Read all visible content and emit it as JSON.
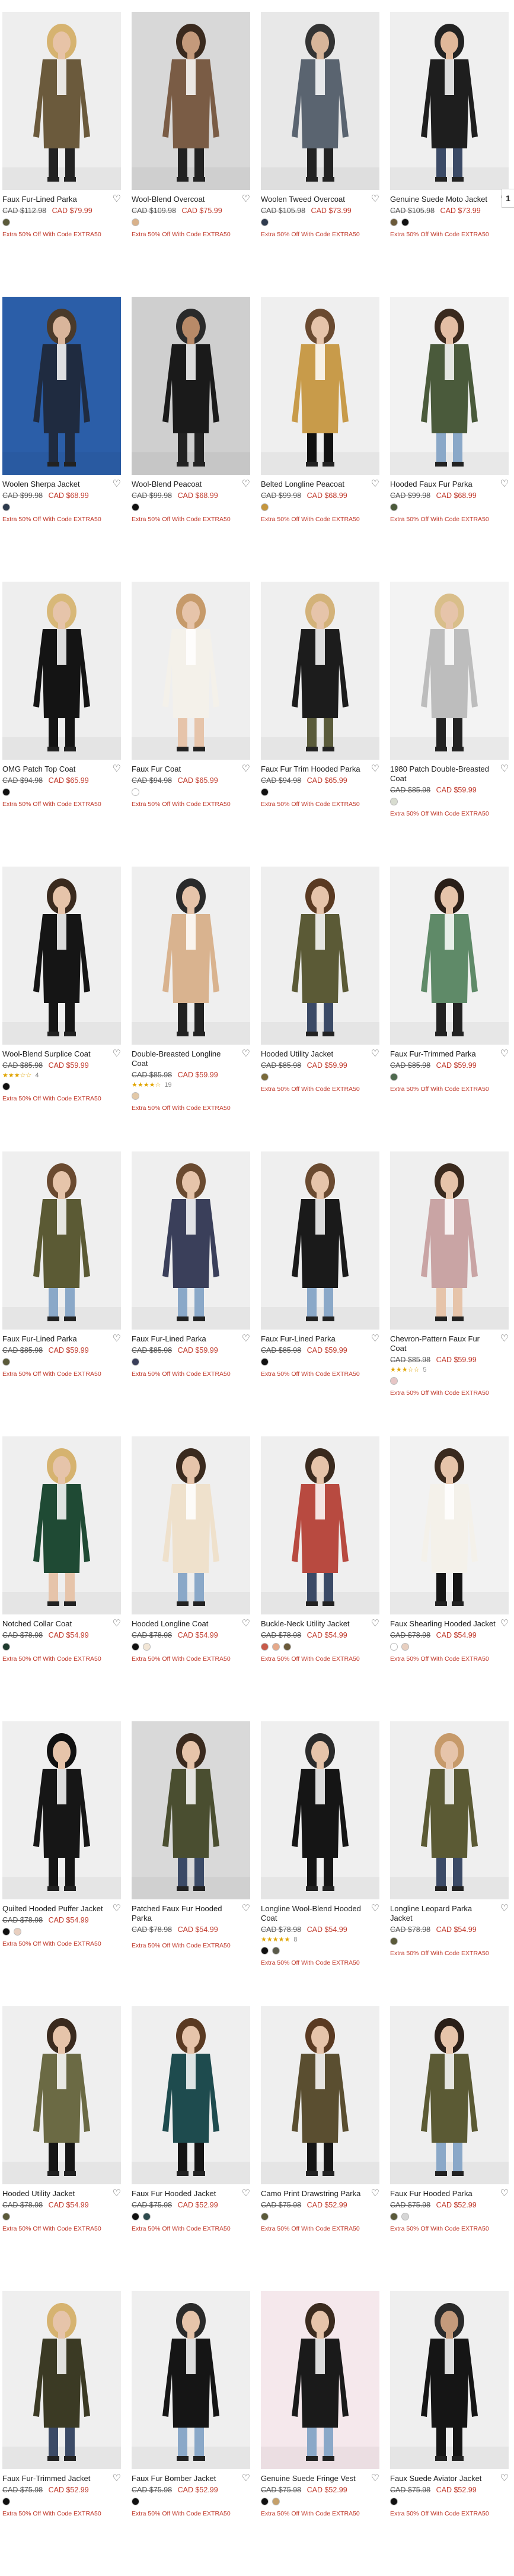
{
  "promo_text": "Extra 50% Off With Code EXTRA50",
  "side_tab_label": "1",
  "products": [
    {
      "title": "Faux Fur-Lined Parka",
      "old": "CAD $112.98",
      "now": "CAD $79.99",
      "swatches": [
        "#5b5a3a"
      ],
      "bg": "#eeeeee",
      "coat": "#6b5a3c",
      "skin": "#e7c3a7",
      "hair": "#d6b370",
      "legs": "#222222"
    },
    {
      "title": "Wool-Blend Overcoat",
      "old": "CAD $109.98",
      "now": "CAD $75.99",
      "swatches": [
        "#d9b28b"
      ],
      "bg": "#d8d8d8",
      "coat": "#7a5c45",
      "skin": "#c49a7b",
      "hair": "#3a2a1e",
      "legs": "#222222"
    },
    {
      "title": "Woolen Tweed Overcoat",
      "old": "CAD $105.98",
      "now": "CAD $73.99",
      "swatches": [
        "#2e3b4e"
      ],
      "bg": "#e8e8e8",
      "coat": "#5a6470",
      "skin": "#d7b59a",
      "hair": "#333333",
      "legs": "#222222"
    },
    {
      "title": "Genuine Suede Moto Jacket",
      "old": "CAD $105.98",
      "now": "CAD $73.99",
      "swatches": [
        "#6b5a3a",
        "#111111"
      ],
      "bg": "#efefef",
      "coat": "#1e1e1e",
      "skin": "#e0b89a",
      "hair": "#222222",
      "legs": "#3b4a66"
    },
    {
      "title": "Woolen Sherpa Jacket",
      "old": "CAD $99.98",
      "now": "CAD $68.99",
      "swatches": [
        "#2e3b4e"
      ],
      "bg": "#2b5ea8",
      "coat": "#1f2b40",
      "skin": "#d9b59b",
      "hair": "#4a3a2a",
      "legs": "#1f2b40"
    },
    {
      "title": "Wool-Blend Peacoat",
      "old": "CAD $99.98",
      "now": "CAD $68.99",
      "swatches": [
        "#111111"
      ],
      "bg": "#cfcfcf",
      "coat": "#1a1a1a",
      "skin": "#b88a68",
      "hair": "#2a2a2a",
      "legs": "#222222"
    },
    {
      "title": "Belted Longline Peacoat",
      "old": "CAD $99.98",
      "now": "CAD $68.99",
      "swatches": [
        "#c5963e"
      ],
      "bg": "#efefef",
      "coat": "#c89b4a",
      "skin": "#e6c4aa",
      "hair": "#6a4a30",
      "legs": "#111111"
    },
    {
      "title": "Hooded Faux Fur Parka",
      "old": "CAD $99.98",
      "now": "CAD $68.99",
      "swatches": [
        "#4b5a3a"
      ],
      "bg": "#f2f2f2",
      "coat": "#4a5a3b",
      "skin": "#e3bea4",
      "hair": "#3a2a1e",
      "legs": "#8aa8c8"
    },
    {
      "title": "OMG Patch Top Coat",
      "old": "CAD $94.98",
      "now": "CAD $65.99",
      "swatches": [
        "#111111"
      ],
      "bg": "#eeeeee",
      "coat": "#141414",
      "skin": "#e6c4aa",
      "hair": "#d8b878",
      "legs": "#141414"
    },
    {
      "title": "Faux Fur Coat",
      "old": "CAD $94.98",
      "now": "CAD $65.99",
      "swatches": [
        "#ffffff"
      ],
      "bg": "#efefef",
      "coat": "#f4f1ea",
      "skin": "#e6c4aa",
      "hair": "#c69a6a",
      "legs": "#e6c4aa"
    },
    {
      "title": "Faux Fur Trim Hooded Parka",
      "old": "CAD $94.98",
      "now": "CAD $65.99",
      "swatches": [
        "#111111"
      ],
      "bg": "#efefef",
      "coat": "#1c1c1c",
      "skin": "#e6c4aa",
      "hair": "#d3b279",
      "legs": "#5a5b3a"
    },
    {
      "title": "1980 Patch Double-Breasted Coat",
      "old": "CAD $85.98",
      "now": "CAD $59.99",
      "swatches": [
        "#d8dcd0"
      ],
      "bg": "#f3f3f3",
      "coat": "#bdbdbd",
      "skin": "#e6c4aa",
      "hair": "#d9be8a",
      "legs": "#222222"
    },
    {
      "title": "Wool-Blend Surplice Coat",
      "old": "CAD $85.98",
      "now": "CAD $59.99",
      "swatches": [
        "#111111"
      ],
      "bg": "#efefef",
      "coat": "#151515",
      "skin": "#e6c4aa",
      "hair": "#3a2a1e",
      "legs": "#151515",
      "stars": "★★★☆☆",
      "reviews": "4"
    },
    {
      "title": "Double-Breasted Longline Coat",
      "old": "CAD $85.98",
      "now": "CAD $59.99",
      "swatches": [
        "#e3c9a8"
      ],
      "bg": "#efefef",
      "coat": "#d9b38f",
      "skin": "#e6c4aa",
      "hair": "#2a2a2a",
      "legs": "#222222",
      "stars": "★★★★☆",
      "reviews": "19"
    },
    {
      "title": "Hooded Utility Jacket",
      "old": "CAD $85.98",
      "now": "CAD $59.99",
      "swatches": [
        "#7a6a3a"
      ],
      "bg": "#efefef",
      "coat": "#5b5a36",
      "skin": "#e6c4aa",
      "hair": "#5a3a22",
      "legs": "#3b4a66"
    },
    {
      "title": "Faux Fur-Trimmed Parka",
      "old": "CAD $85.98",
      "now": "CAD $59.99",
      "swatches": [
        "#4e6a4e"
      ],
      "bg": "#f1f1f1",
      "coat": "#5f8a68",
      "skin": "#e6c4aa",
      "hair": "#2a1f18",
      "legs": "#222222"
    },
    {
      "title": "Faux Fur-Lined Parka",
      "old": "CAD $85.98",
      "now": "CAD $59.99",
      "swatches": [
        "#5b5a3a"
      ],
      "bg": "#efefef",
      "coat": "#5b5a34",
      "skin": "#e6c4aa",
      "hair": "#6a4a30",
      "legs": "#8aa8c8"
    },
    {
      "title": "Faux Fur-Lined Parka",
      "old": "CAD $85.98",
      "now": "CAD $59.99",
      "swatches": [
        "#3a3f5a"
      ],
      "bg": "#efefef",
      "coat": "#3a3f5a",
      "skin": "#e6c4aa",
      "hair": "#6a4a30",
      "legs": "#8aa8c8"
    },
    {
      "title": "Faux Fur-Lined Parka",
      "old": "CAD $85.98",
      "now": "CAD $59.99",
      "swatches": [
        "#111111"
      ],
      "bg": "#efefef",
      "coat": "#1a1a1a",
      "skin": "#e6c4aa",
      "hair": "#6a4a30",
      "legs": "#8aa8c8"
    },
    {
      "title": "Chevron-Pattern Faux Fur Coat",
      "old": "CAD $85.98",
      "now": "CAD $59.99",
      "swatches": [
        "#e6c6c6"
      ],
      "bg": "#efefef",
      "coat": "#c9a4a4",
      "skin": "#e6c4aa",
      "hair": "#3a2a1e",
      "legs": "#e6c4aa",
      "stars": "★★★☆☆",
      "reviews": "5"
    },
    {
      "title": "Notched Collar Coat",
      "old": "CAD $78.98",
      "now": "CAD $54.99",
      "swatches": [
        "#1f3b2e"
      ],
      "bg": "#efefef",
      "coat": "#1f4a34",
      "skin": "#e6c4aa",
      "hair": "#d6b370",
      "legs": "#e6c4aa"
    },
    {
      "title": "Hooded Longline Coat",
      "old": "CAD $78.98",
      "now": "CAD $54.99",
      "swatches": [
        "#111111",
        "#f2e6d6"
      ],
      "bg": "#efefef",
      "coat": "#efe1cc",
      "skin": "#e6c4aa",
      "hair": "#3a2a1e",
      "legs": "#8aa8c8"
    },
    {
      "title": "Buckle-Neck Utility Jacket",
      "old": "CAD $78.98",
      "now": "CAD $54.99",
      "swatches": [
        "#c85a4a",
        "#e6a98a",
        "#6b5a3a"
      ],
      "bg": "#efefef",
      "coat": "#b84a40",
      "skin": "#e6c4aa",
      "hair": "#3a2a1e",
      "legs": "#3b4a66"
    },
    {
      "title": "Faux Shearling Hooded Jacket",
      "old": "CAD $78.98",
      "now": "CAD $54.99",
      "swatches": [
        "#ffffff",
        "#e8cfc0"
      ],
      "bg": "#f2f2f2",
      "coat": "#f4f1ea",
      "skin": "#e6c4aa",
      "hair": "#3a2a1e",
      "legs": "#151515"
    },
    {
      "title": "Quilted Hooded Puffer Jacket",
      "old": "CAD $78.98",
      "now": "CAD $54.99",
      "swatches": [
        "#111111",
        "#e8cfc0"
      ],
      "bg": "#efefef",
      "coat": "#161616",
      "skin": "#e6c4aa",
      "hair": "#111111",
      "legs": "#151515"
    },
    {
      "title": "Patched Faux Fur Hooded Parka",
      "old": "CAD $78.98",
      "now": "CAD $54.99",
      "swatches": [],
      "bg": "#d9d9d9",
      "coat": "#4a4e30",
      "skin": "#e6c4aa",
      "hair": "#3a2a1e",
      "legs": "#3b4a66"
    },
    {
      "title": "Longline Wool-Blend Hooded Coat",
      "old": "CAD $78.98",
      "now": "CAD $54.99",
      "swatches": [
        "#111111",
        "#5a5a4a"
      ],
      "bg": "#efefef",
      "coat": "#151515",
      "skin": "#e6c4aa",
      "hair": "#2a2a2a",
      "legs": "#151515",
      "stars": "★★★★★",
      "reviews": "8"
    },
    {
      "title": "Longline Leopard Parka Jacket",
      "old": "CAD $78.98",
      "now": "CAD $54.99",
      "swatches": [
        "#5b5a3a"
      ],
      "bg": "#efefef",
      "coat": "#5b5a34",
      "skin": "#e6c4aa",
      "hair": "#c69a6a",
      "legs": "#3b4a66"
    },
    {
      "title": "Hooded Utility Jacket",
      "old": "CAD $78.98",
      "now": "CAD $54.99",
      "swatches": [
        "#5b5a3a"
      ],
      "bg": "#efefef",
      "coat": "#6b6a44",
      "skin": "#e6c4aa",
      "hair": "#3a2a1e",
      "legs": "#151515"
    },
    {
      "title": "Faux Fur Hooded Jacket",
      "old": "CAD $75.98",
      "now": "CAD $52.99",
      "swatches": [
        "#111111",
        "#2e4b4e"
      ],
      "bg": "#efefef",
      "coat": "#1e4b4e",
      "skin": "#e6c4aa",
      "hair": "#5a3a22",
      "legs": "#151515"
    },
    {
      "title": "Camo Print Drawstring Parka",
      "old": "CAD $75.98",
      "now": "CAD $52.99",
      "swatches": [
        "#5b5a3a"
      ],
      "bg": "#efefef",
      "coat": "#5a4e30",
      "skin": "#e6c4aa",
      "hair": "#5a3a22",
      "legs": "#151515"
    },
    {
      "title": "Faux Fur Hooded Parka",
      "old": "CAD $75.98",
      "now": "CAD $52.99",
      "swatches": [
        "#5b5a3a",
        "#d6d6d6"
      ],
      "bg": "#efefef",
      "coat": "#5b5a34",
      "skin": "#e6c4aa",
      "hair": "#2a1f18",
      "legs": "#8aa8c8"
    },
    {
      "title": "Faux Fur-Trimmed Jacket",
      "old": "CAD $75.98",
      "now": "CAD $52.99",
      "swatches": [
        "#111111"
      ],
      "bg": "#efefef",
      "coat": "#3b3a24",
      "skin": "#e6c4aa",
      "hair": "#d6b370",
      "legs": "#3b4a66"
    },
    {
      "title": "Faux Fur Bomber Jacket",
      "old": "CAD $75.98",
      "now": "CAD $52.99",
      "swatches": [
        "#111111"
      ],
      "bg": "#efefef",
      "coat": "#151515",
      "skin": "#e6c4aa",
      "hair": "#2a2a2a",
      "legs": "#8aa8c8"
    },
    {
      "title": "Genuine Suede Fringe Vest",
      "old": "CAD $75.98",
      "now": "CAD $52.99",
      "swatches": [
        "#111111",
        "#c5a06a"
      ],
      "bg": "#f5e8ec",
      "coat": "#1a1a1a",
      "skin": "#e6c4aa",
      "hair": "#3a2a1e",
      "legs": "#8aa8c8"
    },
    {
      "title": "Faux Suede Aviator Jacket",
      "old": "CAD $75.98",
      "now": "CAD $52.99",
      "swatches": [
        "#111111"
      ],
      "bg": "#efefef",
      "coat": "#151515",
      "skin": "#c49a7b",
      "hair": "#2a2a2a",
      "legs": "#151515"
    }
  ]
}
